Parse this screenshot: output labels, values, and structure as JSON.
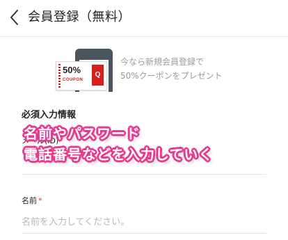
{
  "header": {
    "title": "会員登録（無料）",
    "back_icon": "chevron-left-icon"
  },
  "banner": {
    "coupon_percent": "50%",
    "coupon_word": "COUPON",
    "coupon_mark": "Q",
    "line1": "今なら新規会員登録で",
    "line2": "50%クーポンをプレゼント"
  },
  "form": {
    "section_title": "必須入力情報",
    "email_label": "メール(ID)",
    "name_label": "名前",
    "required_mark": "*",
    "name_placeholder": "名前を入力してください。",
    "name_value": ""
  },
  "overlay": {
    "line1": "名前やパスワード",
    "line2": "電話番号などを入力していく",
    "color": "#e8388f"
  },
  "colors": {
    "coupon_red": "#d62020",
    "required_red": "#e0352b",
    "muted_text": "#9a9a9a"
  }
}
